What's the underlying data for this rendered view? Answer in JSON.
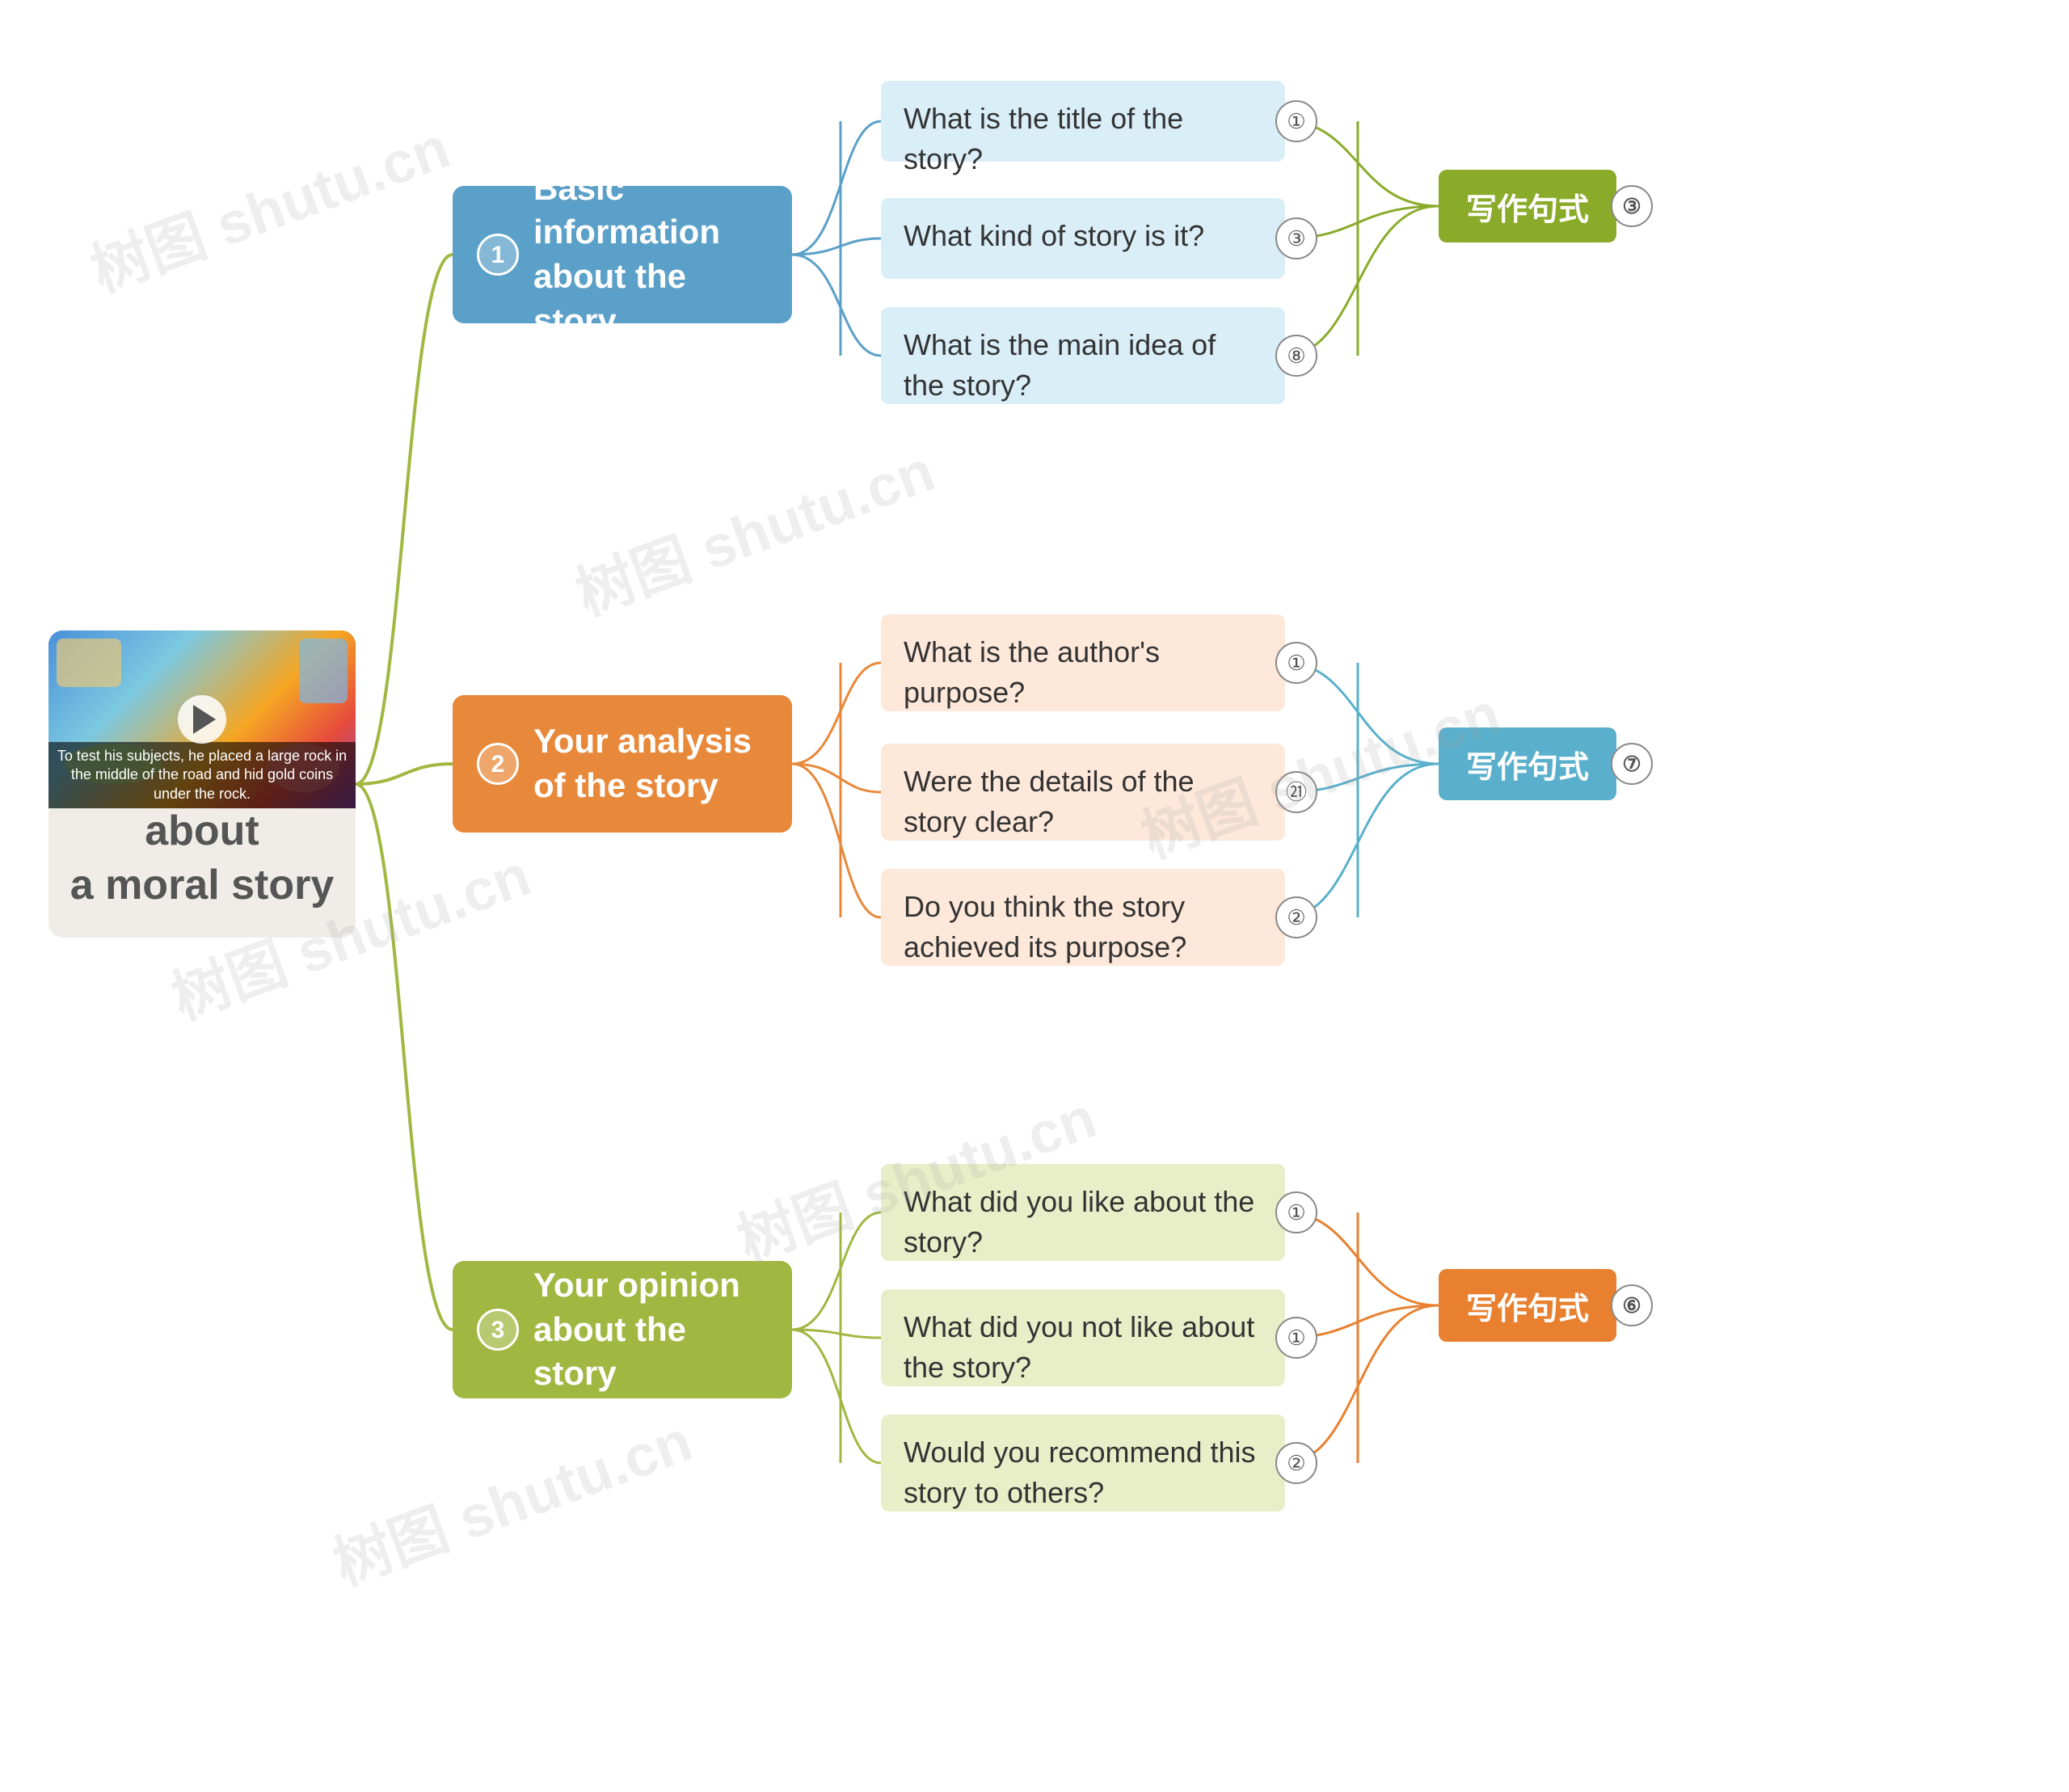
{
  "watermarks": [
    {
      "text": "树图 shutu.cn"
    },
    {
      "text": "树图 shutu.cn"
    },
    {
      "text": "树图 shutu.cn"
    },
    {
      "text": "树图 shutu.cn"
    },
    {
      "text": "树图 shutu.cn"
    },
    {
      "text": "树图 shutu.cn"
    }
  ],
  "root": {
    "title": "Your opinion\nabout\na moral story",
    "image_caption": "To test his subjects, he placed a large rock in the middle\nof the road and hid gold coins under the rock."
  },
  "branches": [
    {
      "id": "branch-1",
      "number": "1",
      "label": "Basic information\nabout the story",
      "color": "#5ba0c8",
      "sub_nodes": [
        {
          "text": "What is the title of the story?",
          "number": "①"
        },
        {
          "text": "What kind of story is it?",
          "number": "③"
        },
        {
          "text": "What is the main idea of the story?",
          "number": "⑧"
        }
      ],
      "writing_node": {
        "label": "写作句式",
        "number": "③"
      }
    },
    {
      "id": "branch-2",
      "number": "2",
      "label": "Your analysis\nof the story",
      "color": "#e8883a",
      "sub_nodes": [
        {
          "text": "What is the author's purpose?",
          "number": "①"
        },
        {
          "text": "Were the details of the story clear?",
          "number": "㉑"
        },
        {
          "text": "Do you think the story achieved its purpose?",
          "number": "②"
        }
      ],
      "writing_node": {
        "label": "写作句式",
        "number": "⑦"
      }
    },
    {
      "id": "branch-3",
      "number": "3",
      "label": "Your opinion\nabout the story",
      "color": "#a0b842",
      "sub_nodes": [
        {
          "text": "What did you like about the story?",
          "number": "①"
        },
        {
          "text": "What did you not like about the story?",
          "number": "①"
        },
        {
          "text": "Would you recommend this story to others?",
          "number": "②"
        }
      ],
      "writing_node": {
        "label": "写作句式",
        "number": "⑥"
      }
    }
  ]
}
